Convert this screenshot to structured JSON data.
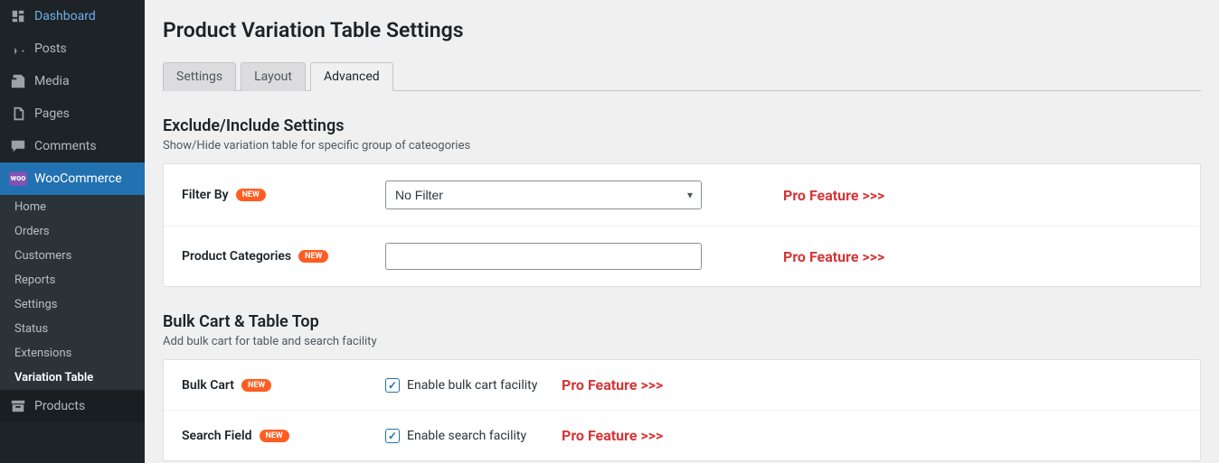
{
  "sidebar": {
    "items": [
      {
        "label": "Dashboard",
        "icon": "dashboard"
      },
      {
        "label": "Posts",
        "icon": "pin"
      },
      {
        "label": "Media",
        "icon": "media"
      },
      {
        "label": "Pages",
        "icon": "pages"
      },
      {
        "label": "Comments",
        "icon": "comment"
      },
      {
        "label": "WooCommerce",
        "icon": "woo",
        "current": true
      },
      {
        "label": "Products",
        "icon": "archive"
      }
    ],
    "woo_submenu": [
      {
        "label": "Home"
      },
      {
        "label": "Orders"
      },
      {
        "label": "Customers"
      },
      {
        "label": "Reports"
      },
      {
        "label": "Settings"
      },
      {
        "label": "Status"
      },
      {
        "label": "Extensions"
      },
      {
        "label": "Variation Table",
        "active": true
      }
    ]
  },
  "page": {
    "title": "Product Variation Table Settings",
    "tabs": [
      {
        "label": "Settings"
      },
      {
        "label": "Layout"
      },
      {
        "label": "Advanced",
        "active": true
      }
    ],
    "sections": [
      {
        "title": "Exclude/Include Settings",
        "desc": "Show/Hide variation table for specific group of cateogories",
        "rows": [
          {
            "label": "Filter By",
            "new_badge": "NEW",
            "type": "select",
            "value": "No Filter",
            "pro_label": "Pro Feature >>>"
          },
          {
            "label": "Product Categories",
            "new_badge": "NEW",
            "type": "text",
            "value": "",
            "pro_label": "Pro Feature >>>"
          }
        ]
      },
      {
        "title": "Bulk Cart & Table Top",
        "desc": "Add bulk cart for table and search facility",
        "rows": [
          {
            "label": "Bulk Cart",
            "new_badge": "NEW",
            "type": "checkbox",
            "checkbox_label": "Enable bulk cart facility",
            "checked": true,
            "pro_label": "Pro Feature >>>"
          },
          {
            "label": "Search Field",
            "new_badge": "NEW",
            "type": "checkbox",
            "checkbox_label": "Enable search facility",
            "checked": true,
            "pro_label": "Pro Feature >>>"
          }
        ]
      }
    ]
  }
}
